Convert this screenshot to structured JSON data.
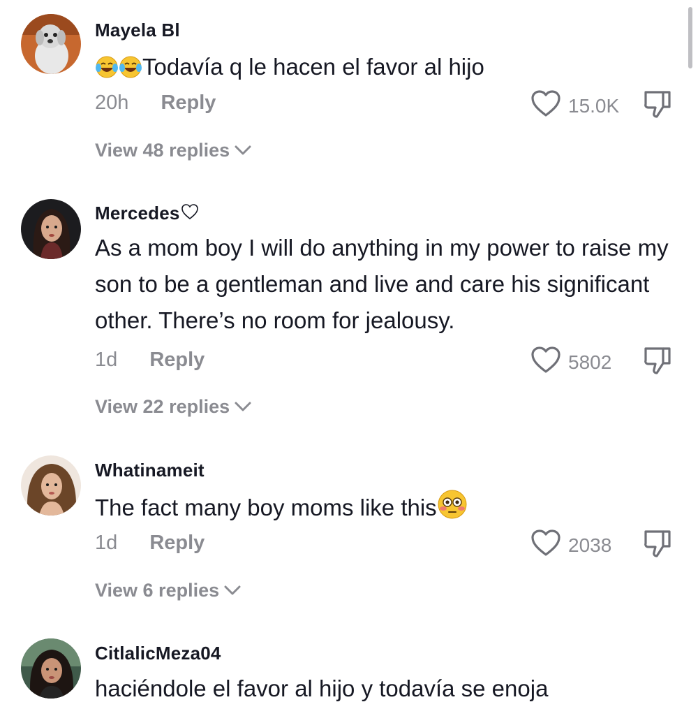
{
  "comments": [
    {
      "username": "Mayela Bl",
      "username_suffix_icon": "",
      "text": "Todavía q le hacen el favor al hijo",
      "text_prefix_emoji": [
        "face-with-tears-of-joy-emoji",
        "face-with-tears-of-joy-emoji"
      ],
      "time": "20h",
      "reply_label": "Reply",
      "likes": "15.0K",
      "view_replies": "View 48 replies"
    },
    {
      "username": "Mercedes",
      "username_suffix_icon": "outline-heart-icon",
      "text": "As a mom boy I will do anything in my power to raise my son to be a gentleman and live and care his significant other. There’s no room for jealousy.",
      "time": "1d",
      "reply_label": "Reply",
      "likes": "5802",
      "view_replies": "View 22 replies"
    },
    {
      "username": "Whatinameit",
      "text": "The fact many boy moms like this",
      "text_suffix_emoji": "flushed-face-emoji",
      "time": "1d",
      "reply_label": "Reply",
      "likes": "2038",
      "view_replies": "View 6 replies"
    },
    {
      "username": "CitlalicMeza04",
      "text": "haciéndole el favor al hijo y todavía se enoja"
    }
  ],
  "colors": {
    "primary_text": "#161823",
    "secondary_text": "#8a8b91",
    "background": "#ffffff"
  }
}
